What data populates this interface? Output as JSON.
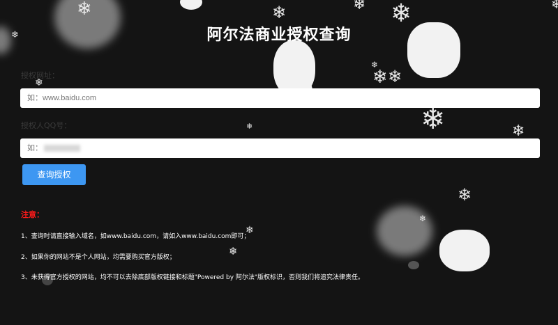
{
  "header": {
    "title": "阿尔法商业授权查询"
  },
  "form": {
    "domain_label": "授权网址：",
    "domain_placeholder": "如：www.baidu.com",
    "qq_label": "授权人QQ号：",
    "qq_prefix": "如："
  },
  "actions": {
    "query_label": "查询授权"
  },
  "notice": {
    "title": "注意：",
    "items": [
      "1、查询时请直接输入域名，如www.baidu.com，请如入www.baidu.com即可；",
      "2、如果你的网站不是个人网站，均需要购买官方版权；",
      "3、未获得官方授权的网站，均不可以去除底部版权链接和标题\"Powered by 阿尔法\"版权标识，否则我们将追究法律责任。"
    ]
  },
  "colors": {
    "background": "#141414",
    "button": "#3d97f2",
    "notice_title": "#ff1a1a"
  }
}
